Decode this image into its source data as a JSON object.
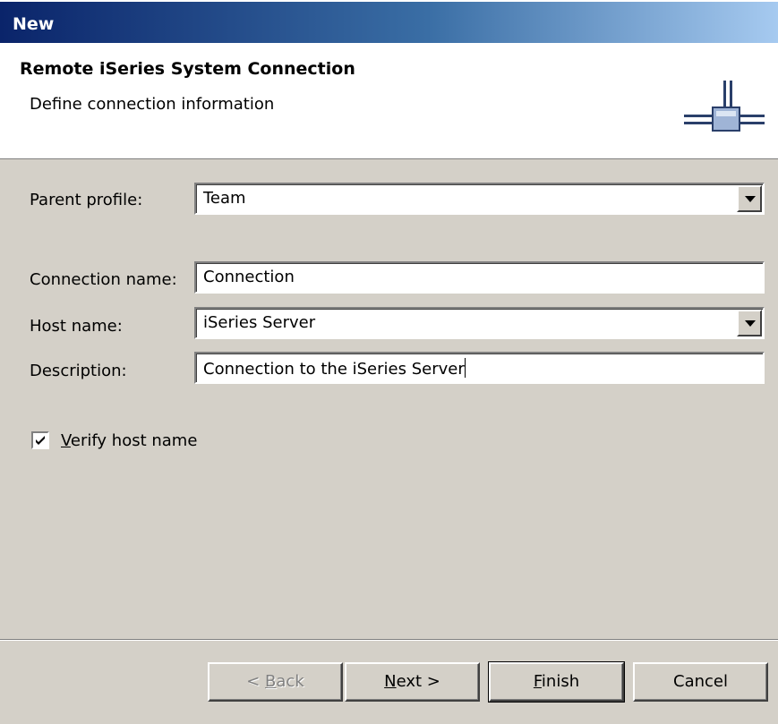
{
  "window": {
    "title": "New"
  },
  "banner": {
    "title": "Remote iSeries System Connection",
    "description": "Define connection information",
    "icon": "connection-icon"
  },
  "form": {
    "parent_profile": {
      "label": "Parent profile:",
      "value": "Team"
    },
    "connection_name": {
      "label": "Connection name:",
      "value": "Connection"
    },
    "host_name": {
      "label": "Host name:",
      "value": "iSeries Server"
    },
    "description": {
      "label": "Description:",
      "value": "Connection to the iSeries Server"
    },
    "verify_host": {
      "label_mnemonic": "V",
      "label_rest": "erify host name",
      "checked": true
    }
  },
  "buttons": {
    "back": {
      "prefix": "< ",
      "mnemonic": "B",
      "rest": "ack",
      "enabled": false
    },
    "next": {
      "mnemonic": "N",
      "rest": "ext >",
      "enabled": true
    },
    "finish": {
      "mnemonic": "F",
      "rest": "inish",
      "enabled": true,
      "default": true
    },
    "cancel": {
      "label": "Cancel",
      "enabled": true
    }
  },
  "colors": {
    "titlebar_start": "#0a246a",
    "titlebar_end": "#a6caf0",
    "dialog_bg": "#d4d0c8"
  }
}
